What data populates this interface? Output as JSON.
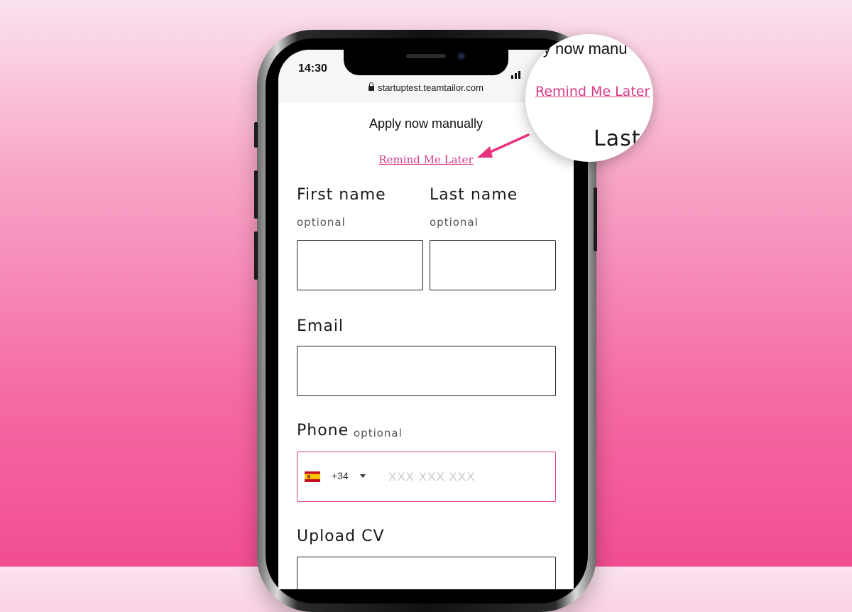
{
  "status_bar": {
    "time": "14:30"
  },
  "browser": {
    "url": "startuptest.teamtailor.com"
  },
  "form": {
    "heading": "Apply now manually",
    "remind_link": "Remind Me Later",
    "first_name": {
      "label": "First name",
      "note": "optional",
      "value": ""
    },
    "last_name": {
      "label": "Last name",
      "note": "optional",
      "value": ""
    },
    "email": {
      "label": "Email",
      "value": ""
    },
    "phone": {
      "label": "Phone",
      "note": "optional",
      "country_code": "+34",
      "placeholder": "XXX XXX XXX"
    },
    "upload": {
      "label": "Upload CV"
    }
  },
  "zoom": {
    "top_text": "ly now manu",
    "remind_link": "Remind Me Later",
    "last_text": "Last"
  },
  "colors": {
    "accent": "#d63a85",
    "background_top": "#fbe3ee",
    "background_bottom": "#f24d92"
  },
  "icons": [
    "lock-icon",
    "signal-icon",
    "spain-flag-icon",
    "dropdown-caret-icon",
    "arrow-icon"
  ]
}
